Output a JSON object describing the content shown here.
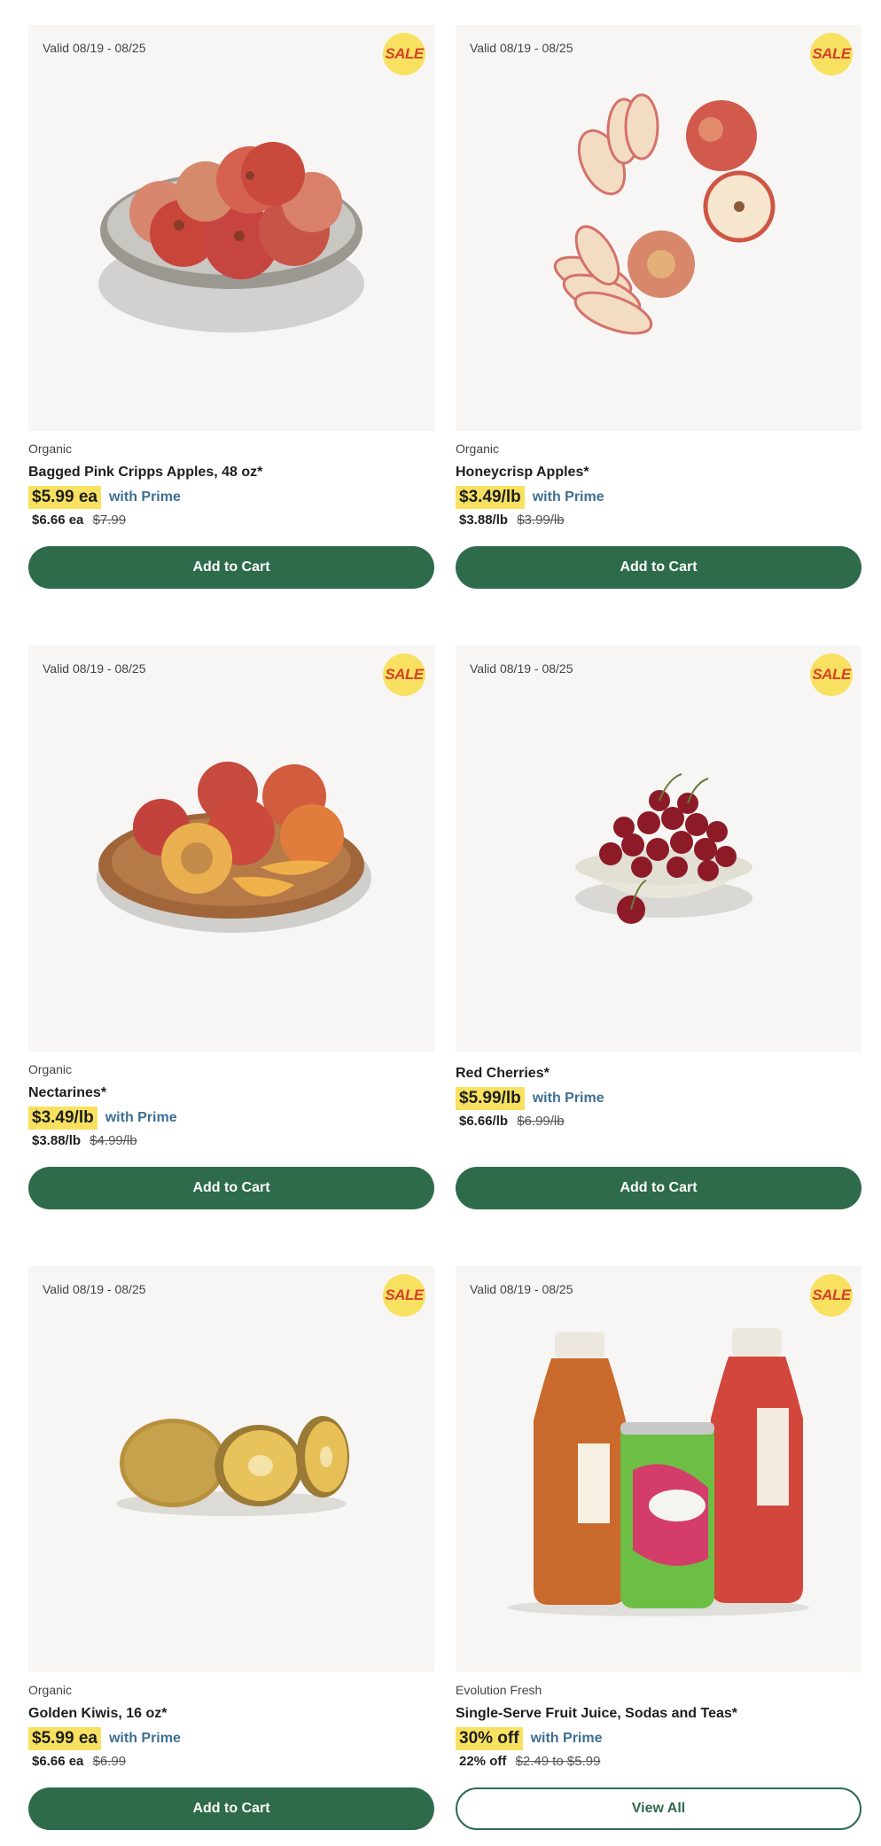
{
  "products": [
    {
      "valid": "Valid 08/19 - 08/25",
      "badge": "SALE",
      "brand": "Organic",
      "title": "Bagged Pink Cripps Apples, 48 oz*",
      "sale_price": "$5.99 ea",
      "prime_label": "with Prime",
      "reg_price": "$6.66 ea",
      "orig_price": "$7.99",
      "button": "Add to Cart",
      "image_icon": "apple-bowl-image"
    },
    {
      "valid": "Valid 08/19 - 08/25",
      "badge": "SALE",
      "brand": "Organic",
      "title": "Honeycrisp Apples*",
      "sale_price": "$3.49/lb",
      "prime_label": "with Prime",
      "reg_price": "$3.88/lb",
      "orig_price": "$3.99/lb",
      "button": "Add to Cart",
      "image_icon": "sliced-apples-image"
    },
    {
      "valid": "Valid 08/19 - 08/25",
      "badge": "SALE",
      "brand": "Organic",
      "title": "Nectarines*",
      "sale_price": "$3.49/lb",
      "prime_label": "with Prime",
      "reg_price": "$3.88/lb",
      "orig_price": "$4.99/lb",
      "button": "Add to Cart",
      "image_icon": "nectarine-plate-image"
    },
    {
      "valid": "Valid 08/19 - 08/25",
      "badge": "SALE",
      "brand": "",
      "title": "Red Cherries*",
      "sale_price": "$5.99/lb",
      "prime_label": "with Prime",
      "reg_price": "$6.66/lb",
      "orig_price": "$6.99/lb",
      "button": "Add to Cart",
      "image_icon": "cherry-bowl-image"
    },
    {
      "valid": "Valid 08/19 - 08/25",
      "badge": "SALE",
      "brand": "Organic",
      "title": "Golden Kiwis, 16 oz*",
      "sale_price": "$5.99 ea",
      "prime_label": "with Prime",
      "reg_price": "$6.66 ea",
      "orig_price": "$6.99",
      "button": "Add to Cart",
      "image_icon": "golden-kiwi-image"
    },
    {
      "valid": "Valid 08/19 - 08/25",
      "badge": "SALE",
      "brand": "Evolution Fresh",
      "title": "Single-Serve Fruit Juice, Sodas and Teas*",
      "sale_price": "30% off",
      "prime_label": "with Prime",
      "reg_price": "22% off",
      "orig_price": "$2.49 to $5.99",
      "button": "View All",
      "image_icon": "juice-bottles-image"
    }
  ],
  "colors": {
    "accent_green": "#2e6b4a",
    "sale_yellow": "#f8e160",
    "prime_blue": "#3e6f93",
    "sale_red": "#d4412b"
  }
}
